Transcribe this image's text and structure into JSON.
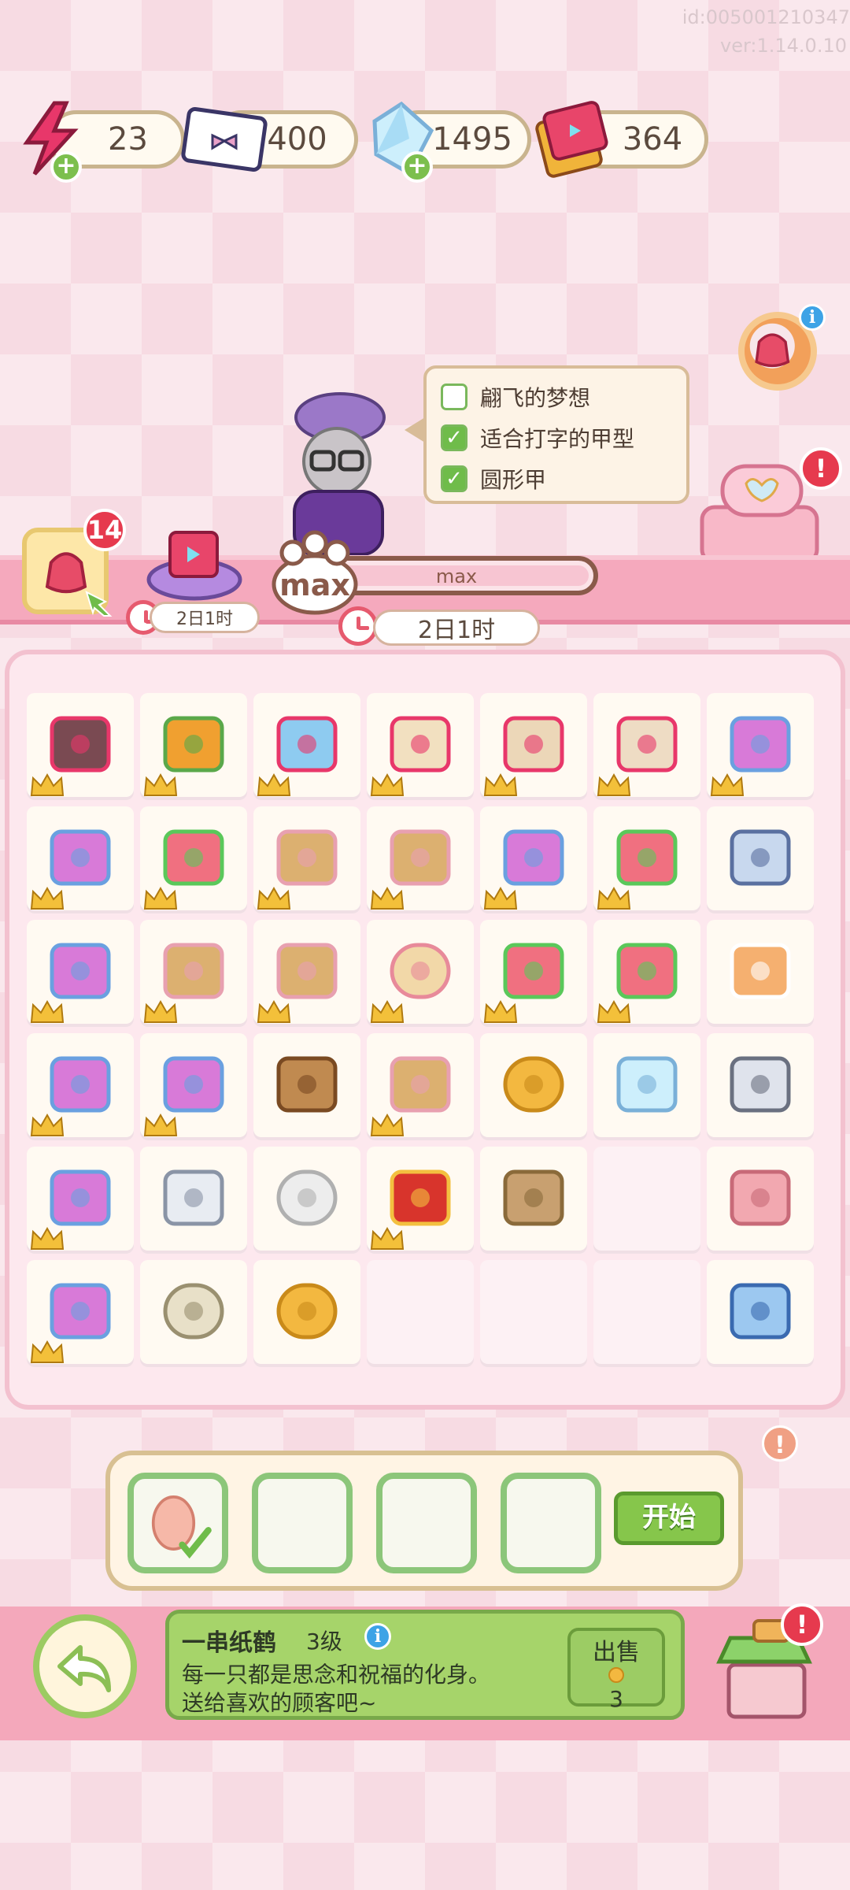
{
  "build": {
    "id": "id:005001210347",
    "version": "ver:1.14.0.10"
  },
  "currencies": [
    {
      "name": "energy",
      "value": "23",
      "icon": "lightning-icon",
      "addable": true
    },
    {
      "name": "ticket",
      "value": "400",
      "icon": "bow-ticket-icon",
      "addable": false
    },
    {
      "name": "crystal",
      "value": "1495",
      "icon": "crystal-icon",
      "addable": true
    },
    {
      "name": "card",
      "value": "364",
      "icon": "card-pack-icon",
      "addable": false
    }
  ],
  "checklist": [
    {
      "label": "翩飞的梦想",
      "checked": false
    },
    {
      "label": "适合打字的甲型",
      "checked": true
    },
    {
      "label": "圆形甲",
      "checked": true
    }
  ],
  "generator": {
    "badge": "14",
    "timer": "2日1时"
  },
  "progress": {
    "label": "max",
    "timer": "2日1时",
    "fill": 1.0
  },
  "grid_items": [
    [
      "crystal-shard",
      "bouquet",
      "ice-crystal",
      "heart-box",
      "round-box",
      "jewel-box",
      "memo-basket"
    ],
    [
      "memo-basket",
      "paper-cranes",
      "gift-box",
      "gift-box",
      "memo-basket",
      "paper-cranes",
      "paper-note"
    ],
    [
      "memo-basket",
      "gift-box",
      "gift-box",
      "heart-cookie",
      "paper-cranes",
      "paper-cranes",
      "iced-drink"
    ],
    [
      "memo-basket",
      "memo-basket",
      "chocolate-box",
      "gift-box",
      "gold-coin",
      "crystal",
      "silver-ticket"
    ],
    [
      "memo-basket",
      "silver-foil",
      "heart-stone",
      "red-envelope",
      "twine-bow",
      "",
      "compact-mirror"
    ],
    [
      "memo-basket",
      "white-stone",
      "coin-stack",
      "",
      "",
      "",
      "blue-ticket"
    ]
  ],
  "crowned": [
    [
      1,
      1,
      1,
      1,
      1,
      1,
      1
    ],
    [
      1,
      1,
      1,
      1,
      1,
      1,
      0
    ],
    [
      1,
      1,
      1,
      1,
      1,
      1,
      0
    ],
    [
      1,
      1,
      0,
      1,
      0,
      0,
      0
    ],
    [
      1,
      0,
      0,
      1,
      0,
      0,
      0
    ],
    [
      1,
      0,
      0,
      0,
      0,
      0,
      0
    ]
  ],
  "order": {
    "start_label": "开始"
  },
  "detail": {
    "name": "一串纸鹤",
    "level": "3级",
    "line1": "每一只都是思念和祝福的化身。",
    "line2": "送给喜欢的顾客吧~",
    "sell_label": "出售",
    "sell_price": "3"
  },
  "badges": {
    "info": "i",
    "alert": "!"
  },
  "colors": {
    "accent": "#f4a8bb",
    "green": "#86c64b",
    "alert": "#e63a4e"
  }
}
